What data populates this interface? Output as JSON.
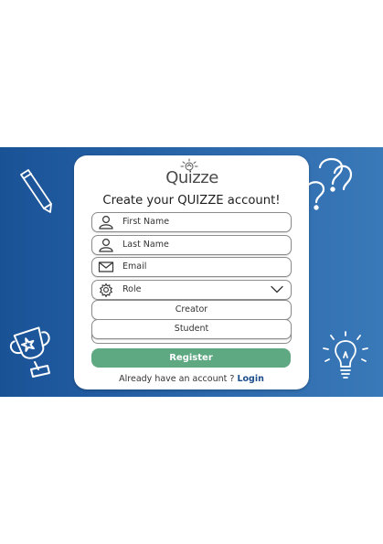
{
  "brand": {
    "name": "Quizze"
  },
  "heading": "Create your QUIZZE account!",
  "form": {
    "first_name_placeholder": "First Name",
    "last_name_placeholder": "Last Name",
    "email_placeholder": "Email",
    "role_placeholder": "Role",
    "role_options": [
      "Creator",
      "Student"
    ]
  },
  "register_label": "Register",
  "login_prompt": "Already have an account ?",
  "login_link": "Login",
  "colors": {
    "banner": "#1a5296",
    "register": "#5ea882",
    "link": "#1d4f8c"
  }
}
